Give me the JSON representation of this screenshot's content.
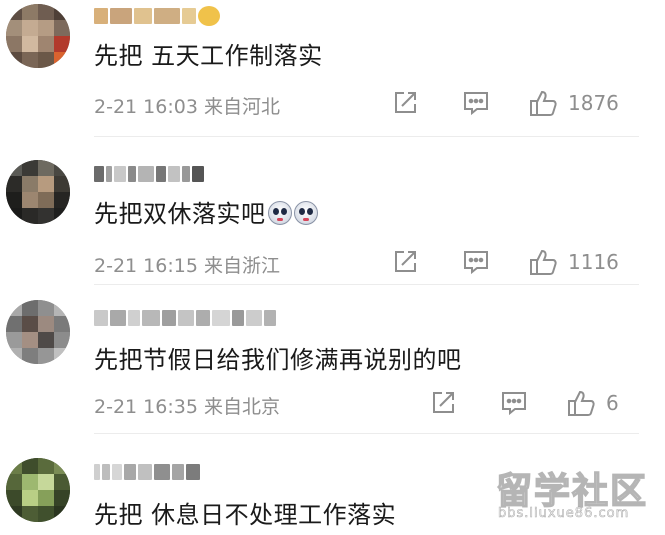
{
  "comments": [
    {
      "text": "先把 五天工作制落实",
      "date": "2-21 16:03",
      "location": "来自河北",
      "likes": "1876",
      "avatar_icon": "user-avatar-icon"
    },
    {
      "text": "先把双休落实吧",
      "date": "2-21 16:15",
      "location": "来自浙江",
      "likes": "1116",
      "avatar_icon": "user-avatar-icon"
    },
    {
      "text": "先把节假日给我们修满再说别的吧",
      "date": "2-21 16:35",
      "location": "来自北京",
      "likes": "6",
      "avatar_icon": "user-avatar-icon"
    },
    {
      "text": "先把 休息日不处理工作落实",
      "date": "",
      "location": "",
      "likes": "",
      "avatar_icon": "user-avatar-icon"
    }
  ],
  "icons": {
    "share": "share-icon",
    "reply": "comment-icon",
    "like": "thumbs-up-icon",
    "emoji": "crying-face-emoji-icon"
  },
  "watermark": {
    "title": "留学社区",
    "url": "bbs.liuxue86.com"
  },
  "colors": {
    "text": "#1a1a1a",
    "meta": "#8e8e8e",
    "divider": "#ececec",
    "background": "#ffffff"
  }
}
